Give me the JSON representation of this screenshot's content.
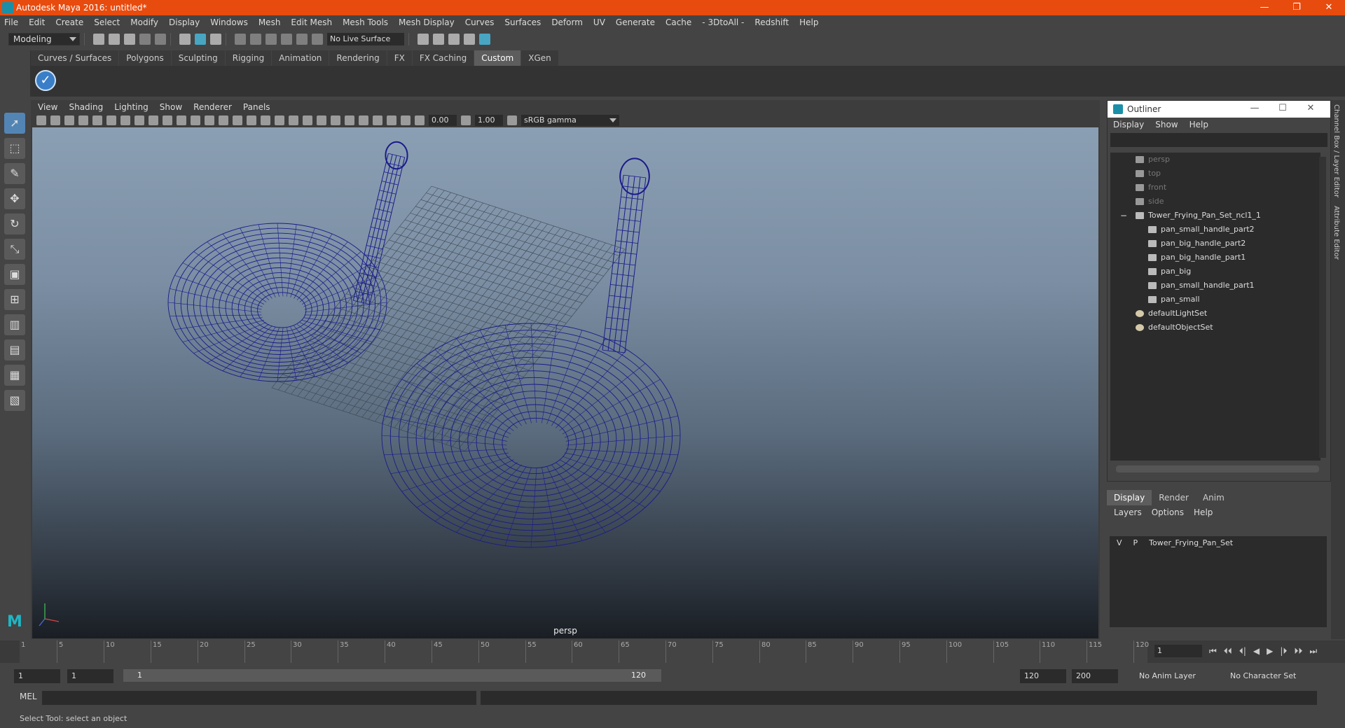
{
  "window": {
    "title": "Autodesk Maya 2016: untitled*",
    "controls": [
      "—",
      "❐",
      "✕"
    ]
  },
  "menubar": [
    "File",
    "Edit",
    "Create",
    "Select",
    "Modify",
    "Display",
    "Windows",
    "Mesh",
    "Edit Mesh",
    "Mesh Tools",
    "Mesh Display",
    "Curves",
    "Surfaces",
    "Deform",
    "UV",
    "Generate",
    "Cache",
    "- 3DtoAll -",
    "Redshift",
    "Help"
  ],
  "status": {
    "mode": "Modeling",
    "live_surface": "No Live Surface"
  },
  "shelf_tabs": [
    "Curves / Surfaces",
    "Polygons",
    "Sculpting",
    "Rigging",
    "Animation",
    "Rendering",
    "FX",
    "FX Caching",
    "Custom",
    "XGen"
  ],
  "shelf_active": "Custom",
  "viewport": {
    "menu": [
      "View",
      "Shading",
      "Lighting",
      "Show",
      "Renderer",
      "Panels"
    ],
    "exposure": "0.00",
    "gamma_value": "1.00",
    "color_space": "sRGB gamma",
    "camera": "persp"
  },
  "outliner": {
    "title": "Outliner",
    "menu": [
      "Display",
      "Show",
      "Help"
    ],
    "items": [
      {
        "label": "persp",
        "icon": "camera-icon",
        "depth": 2,
        "dim": true
      },
      {
        "label": "top",
        "icon": "camera-icon",
        "depth": 2,
        "dim": true
      },
      {
        "label": "front",
        "icon": "camera-icon",
        "depth": 2,
        "dim": true
      },
      {
        "label": "side",
        "icon": "camera-icon",
        "depth": 2,
        "dim": true
      },
      {
        "label": "Tower_Frying_Pan_Set_ncl1_1",
        "icon": "group-icon",
        "depth": 2,
        "dim": false,
        "expander": "−"
      },
      {
        "label": "pan_small_handle_part2",
        "icon": "mesh-icon",
        "depth": 3,
        "dim": false
      },
      {
        "label": "pan_big_handle_part2",
        "icon": "mesh-icon",
        "depth": 3,
        "dim": false
      },
      {
        "label": "pan_big_handle_part1",
        "icon": "mesh-icon",
        "depth": 3,
        "dim": false
      },
      {
        "label": "pan_big",
        "icon": "mesh-icon",
        "depth": 3,
        "dim": false
      },
      {
        "label": "pan_small_handle_part1",
        "icon": "mesh-icon",
        "depth": 3,
        "dim": false
      },
      {
        "label": "pan_small",
        "icon": "mesh-icon",
        "depth": 3,
        "dim": false
      },
      {
        "label": "defaultLightSet",
        "icon": "set-icon",
        "depth": 2,
        "dim": false
      },
      {
        "label": "defaultObjectSet",
        "icon": "set-icon",
        "depth": 2,
        "dim": false
      }
    ]
  },
  "layers": {
    "tabs": [
      "Display",
      "Render",
      "Anim"
    ],
    "active_tab": "Display",
    "menu": [
      "Layers",
      "Options",
      "Help"
    ],
    "rows": [
      {
        "v": "V",
        "p": "P",
        "name": "Tower_Frying_Pan_Set"
      }
    ]
  },
  "side_tabs": [
    "Channel Box / Layer Editor",
    "Attribute Editor"
  ],
  "timeline": {
    "ticks": [
      "5",
      "10",
      "15",
      "20",
      "25",
      "30",
      "35",
      "40",
      "45",
      "50",
      "55",
      "60",
      "65",
      "70",
      "75",
      "80",
      "85",
      "90",
      "95",
      "100",
      "105",
      "110",
      "115",
      "120"
    ],
    "first_tick": "1",
    "current_frame": "1",
    "playback": [
      "⏮",
      "⏴⏴",
      "⏴|",
      "◀",
      "▶",
      "|⏵",
      "⏵⏵",
      "⏭"
    ]
  },
  "range": {
    "start": "1",
    "playback_start": "1",
    "slider_start": "1",
    "slider_end": "120",
    "playback_end": "120",
    "end": "200",
    "anim_layer": "No Anim Layer",
    "character_set": "No Character Set"
  },
  "cmdline": {
    "label": "MEL"
  },
  "helpline": "Select Tool: select an object",
  "colors": {
    "titlebar": "#e84b0e",
    "wire": "#1a1a8a",
    "accent": "#5385b4"
  }
}
